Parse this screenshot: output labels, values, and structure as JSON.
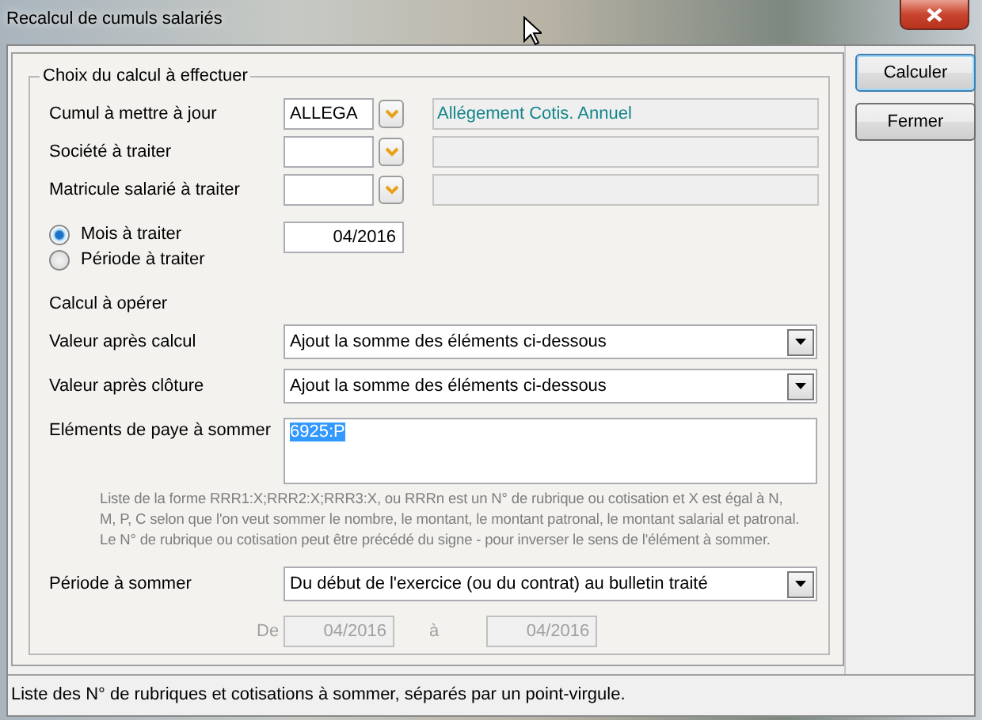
{
  "window": {
    "title": "Recalcul de cumuls salariés"
  },
  "group": {
    "title": "Choix du calcul à effectuer"
  },
  "lookups": [
    {
      "label": "Cumul à mettre à jour",
      "value": "ALLEGA",
      "description": "Allégement Cotis. Annuel"
    },
    {
      "label": "Société à traiter"
    },
    {
      "label": "Matricule salarié à traiter"
    }
  ],
  "mode_options": [
    {
      "label": "Mois à traiter",
      "selected": true
    },
    {
      "label": "Période à traiter",
      "selected": false
    }
  ],
  "month_field": {
    "value": "04/2016"
  },
  "calc_section": {
    "title": "Calcul à opérer"
  },
  "calc_rows": [
    {
      "label": "Valeur après calcul",
      "value": "Ajout la somme des éléments ci-dessous"
    },
    {
      "label": "Valeur après clôture",
      "value": "Ajout la somme des éléments ci-dessous"
    }
  ],
  "elements": {
    "label": "Eléments de paye à sommer",
    "value": "6925:P",
    "selected": true
  },
  "help_text": [
    "Liste de la forme RRR1:X;RRR2:X;RRR3:X, ou RRRn est un N° de rubrique ou cotisation et X est égal à  N,",
    "M, P, C selon que l'on veut sommer le nombre, le montant, le montant patronal, le montant salarial et patronal.",
    "Le N° de rubrique ou cotisation peut être précédé du signe - pour inverser le sens de l'élément à sommer."
  ],
  "period": {
    "label": "Période à sommer",
    "value": "Du début de l'exercice (ou du contrat) au bulletin traité"
  },
  "range": {
    "disabled": true,
    "from_label": "De",
    "from": "04/2016",
    "to_label": "à",
    "to": "04/2016"
  },
  "buttons": [
    {
      "label": "Calculer",
      "default": true
    },
    {
      "label": "Fermer",
      "default": false
    }
  ],
  "status_bar": {
    "text": "Liste des N° de rubriques et cotisations à sommer, séparés par un point-virgule."
  }
}
